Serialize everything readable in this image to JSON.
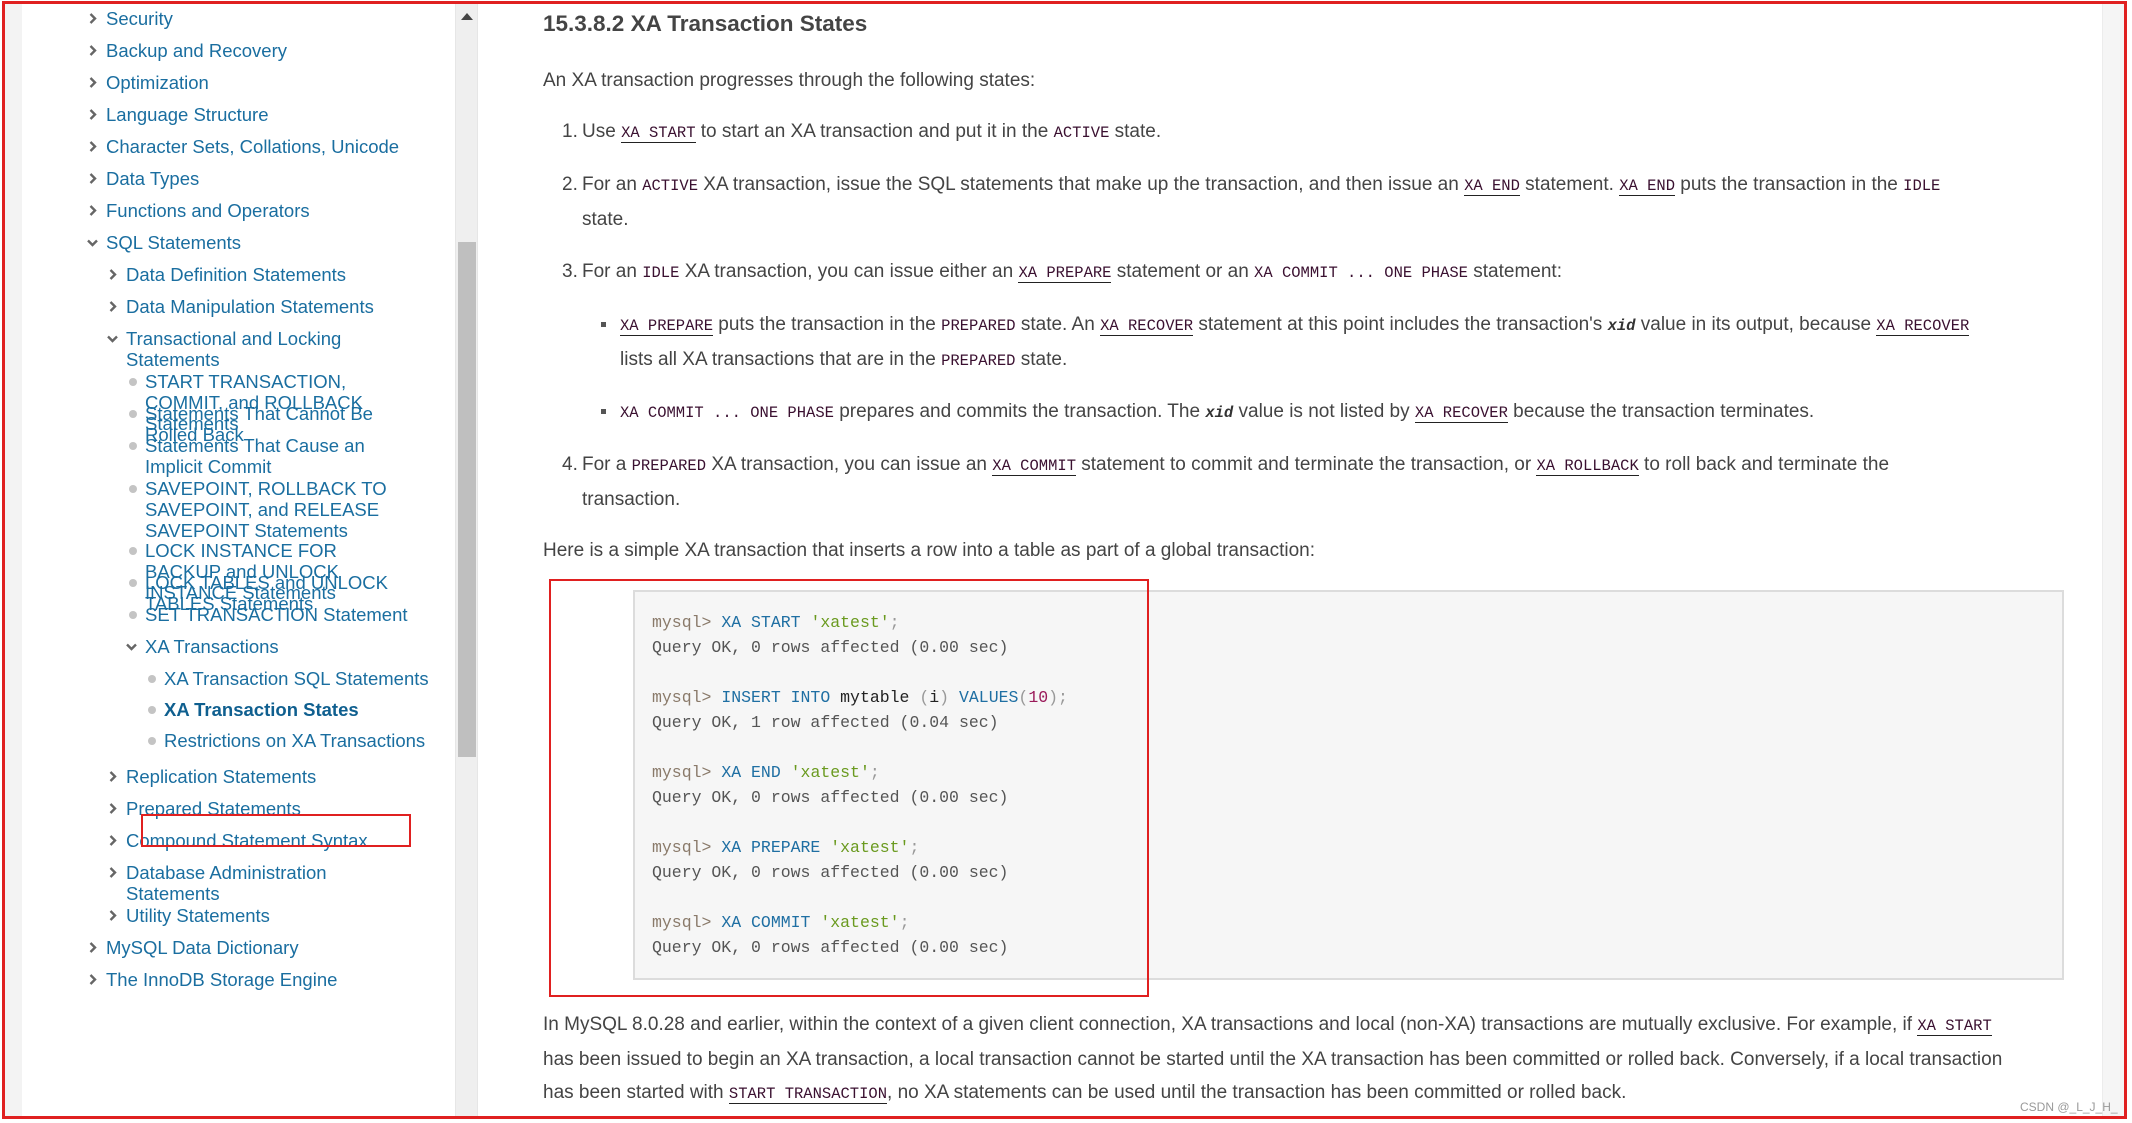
{
  "sidebar": {
    "items": [
      {
        "label": "Security",
        "icon": "chevron-right",
        "level": 0
      },
      {
        "label": "Backup and Recovery",
        "icon": "chevron-right",
        "level": 0
      },
      {
        "label": "Optimization",
        "icon": "chevron-right",
        "level": 0
      },
      {
        "label": "Language Structure",
        "icon": "chevron-right",
        "level": 0
      },
      {
        "label": "Character Sets, Collations, Unicode",
        "icon": "chevron-right",
        "level": 0
      },
      {
        "label": "Data Types",
        "icon": "chevron-right",
        "level": 0
      },
      {
        "label": "Functions and Operators",
        "icon": "chevron-right",
        "level": 0
      },
      {
        "label": "SQL Statements",
        "icon": "chevron-down",
        "level": 0
      },
      {
        "label": "Data Definition Statements",
        "icon": "chevron-right",
        "level": 1
      },
      {
        "label": "Data Manipulation Statements",
        "icon": "chevron-right",
        "level": 1
      },
      {
        "label": "Transactional and Locking Statements",
        "icon": "chevron-down",
        "level": 1
      },
      {
        "label": "START TRANSACTION, COMMIT, and ROLLBACK Statements",
        "icon": "bullet",
        "level": 2
      },
      {
        "label": "Statements That Cannot Be Rolled Back",
        "icon": "bullet",
        "level": 2
      },
      {
        "label": "Statements That Cause an Implicit Commit",
        "icon": "bullet",
        "level": 2
      },
      {
        "label": "SAVEPOINT, ROLLBACK TO SAVEPOINT, and RELEASE SAVEPOINT Statements",
        "icon": "bullet",
        "level": 2
      },
      {
        "label": "LOCK INSTANCE FOR BACKUP and UNLOCK INSTANCE Statements",
        "icon": "bullet",
        "level": 2
      },
      {
        "label": "LOCK TABLES and UNLOCK TABLES Statements",
        "icon": "bullet",
        "level": 2
      },
      {
        "label": "SET TRANSACTION Statement",
        "icon": "bullet",
        "level": 2
      },
      {
        "label": "XA Transactions",
        "icon": "chevron-down",
        "level": 2
      },
      {
        "label": "XA Transaction SQL Statements",
        "icon": "bullet",
        "level": 3
      },
      {
        "label": "XA Transaction States",
        "icon": "bullet",
        "level": 3,
        "current": true
      },
      {
        "label": "Restrictions on XA Transactions",
        "icon": "bullet",
        "level": 3
      },
      {
        "label": "Replication Statements",
        "icon": "chevron-right",
        "level": 1
      },
      {
        "label": "Prepared Statements",
        "icon": "chevron-right",
        "level": 1
      },
      {
        "label": "Compound Statement Syntax",
        "icon": "chevron-right",
        "level": 1
      },
      {
        "label": "Database Administration Statements",
        "icon": "chevron-right",
        "level": 1
      },
      {
        "label": "Utility Statements",
        "icon": "chevron-right",
        "level": 1
      },
      {
        "label": "MySQL Data Dictionary",
        "icon": "chevron-right",
        "level": 0
      },
      {
        "label": "The InnoDB Storage Engine",
        "icon": "chevron-right",
        "level": 0
      }
    ]
  },
  "main": {
    "title": "15.3.8.2 XA Transaction States",
    "intro": "An XA transaction progresses through the following states:",
    "steps": [
      {
        "num": "1.",
        "parts": [
          {
            "t": "Use "
          },
          {
            "link": "XA START"
          },
          {
            "t": " to start an XA transaction and put it in the "
          },
          {
            "code": "ACTIVE"
          },
          {
            "t": " state."
          }
        ]
      },
      {
        "num": "2.",
        "parts": [
          {
            "t": "For an "
          },
          {
            "code": "ACTIVE"
          },
          {
            "t": " XA transaction, issue the SQL statements that make up the transaction, and then issue an "
          },
          {
            "link": "XA END"
          },
          {
            "t": " statement. "
          },
          {
            "link": "XA END"
          },
          {
            "t": " puts the transaction in the "
          },
          {
            "code": "IDLE"
          },
          {
            "t": " state."
          }
        ]
      },
      {
        "num": "3.",
        "parts": [
          {
            "t": "For an "
          },
          {
            "code": "IDLE"
          },
          {
            "t": " XA transaction, you can issue either an "
          },
          {
            "link": "XA PREPARE"
          },
          {
            "t": " statement or an "
          },
          {
            "code": "XA COMMIT ... ONE PHASE"
          },
          {
            "t": " statement:"
          }
        ]
      },
      {
        "num": "4.",
        "parts": [
          {
            "t": "For a "
          },
          {
            "code": "PREPARED"
          },
          {
            "t": " XA transaction, you can issue an "
          },
          {
            "link": "XA COMMIT"
          },
          {
            "t": " statement to commit and terminate the transaction, or "
          },
          {
            "link": "XA ROLLBACK"
          },
          {
            "t": " to roll back and terminate the transaction."
          }
        ]
      }
    ],
    "bullets": [
      {
        "parts": [
          {
            "link": "XA PREPARE"
          },
          {
            "t": " puts the transaction in the "
          },
          {
            "code": "PREPARED"
          },
          {
            "t": " state. An "
          },
          {
            "link": "XA RECOVER"
          },
          {
            "t": " statement at this point includes the transaction's "
          },
          {
            "var": "xid"
          },
          {
            "t": " value in its output, because "
          },
          {
            "link": "XA RECOVER"
          },
          {
            "t": " lists all XA transactions that are in the "
          },
          {
            "code": "PREPARED"
          },
          {
            "t": " state."
          }
        ]
      },
      {
        "parts": [
          {
            "code": "XA COMMIT ... ONE PHASE"
          },
          {
            "t": " prepares and commits the transaction. The "
          },
          {
            "var": "xid"
          },
          {
            "t": " value is not listed by "
          },
          {
            "link": "XA RECOVER"
          },
          {
            "t": " because the transaction terminates."
          }
        ]
      }
    ],
    "example_intro": "Here is a simple XA transaction that inserts a row into a table as part of a global transaction:",
    "code_lines": [
      [
        {
          "c": "prompt",
          "t": "mysql> "
        },
        {
          "c": "kw",
          "t": "XA START"
        },
        {
          "c": "plain",
          "t": " "
        },
        {
          "c": "str",
          "t": "'xatest'"
        },
        {
          "c": "punc",
          "t": ";"
        }
      ],
      [
        {
          "c": "plain",
          "t": "Query OK, 0 rows affected (0.00 sec)"
        }
      ],
      [],
      [
        {
          "c": "prompt",
          "t": "mysql> "
        },
        {
          "c": "kw",
          "t": "INSERT INTO"
        },
        {
          "c": "plain",
          "t": " "
        },
        {
          "c": "id",
          "t": "mytable"
        },
        {
          "c": "plain",
          "t": " "
        },
        {
          "c": "punc",
          "t": "("
        },
        {
          "c": "id",
          "t": "i"
        },
        {
          "c": "punc",
          "t": ")"
        },
        {
          "c": "plain",
          "t": " "
        },
        {
          "c": "kw",
          "t": "VALUES"
        },
        {
          "c": "punc",
          "t": "("
        },
        {
          "c": "num",
          "t": "10"
        },
        {
          "c": "punc",
          "t": ");"
        }
      ],
      [
        {
          "c": "plain",
          "t": "Query OK, 1 row affected (0.04 sec)"
        }
      ],
      [],
      [
        {
          "c": "prompt",
          "t": "mysql> "
        },
        {
          "c": "kw",
          "t": "XA END"
        },
        {
          "c": "plain",
          "t": " "
        },
        {
          "c": "str",
          "t": "'xatest'"
        },
        {
          "c": "punc",
          "t": ";"
        }
      ],
      [
        {
          "c": "plain",
          "t": "Query OK, 0 rows affected (0.00 sec)"
        }
      ],
      [],
      [
        {
          "c": "prompt",
          "t": "mysql> "
        },
        {
          "c": "kw",
          "t": "XA PREPARE"
        },
        {
          "c": "plain",
          "t": " "
        },
        {
          "c": "str",
          "t": "'xatest'"
        },
        {
          "c": "punc",
          "t": ";"
        }
      ],
      [
        {
          "c": "plain",
          "t": "Query OK, 0 rows affected (0.00 sec)"
        }
      ],
      [],
      [
        {
          "c": "prompt",
          "t": "mysql> "
        },
        {
          "c": "kw",
          "t": "XA COMMIT"
        },
        {
          "c": "plain",
          "t": " "
        },
        {
          "c": "str",
          "t": "'xatest'"
        },
        {
          "c": "punc",
          "t": ";"
        }
      ],
      [
        {
          "c": "plain",
          "t": "Query OK, 0 rows affected (0.00 sec)"
        }
      ]
    ],
    "closing": [
      {
        "t": "In MySQL 8.0.28 and earlier, within the context of a given client connection, XA transactions and local (non-XA) transactions are mutually exclusive. For example, if "
      },
      {
        "link": "XA START"
      },
      {
        "t": " has been issued to begin an XA transaction, a local transaction cannot be started until the XA transaction has been committed or rolled back. Conversely, if a local transaction has been started with "
      },
      {
        "link": "START TRANSACTION"
      },
      {
        "t": ", no XA statements can be used until the transaction has been committed or rolled back."
      }
    ]
  },
  "watermark": "CSDN @_L_J_H_",
  "colors": {
    "link": "#1a6ea0",
    "highlight_border": "#e02020",
    "code_bg": "#f6f6f6"
  }
}
